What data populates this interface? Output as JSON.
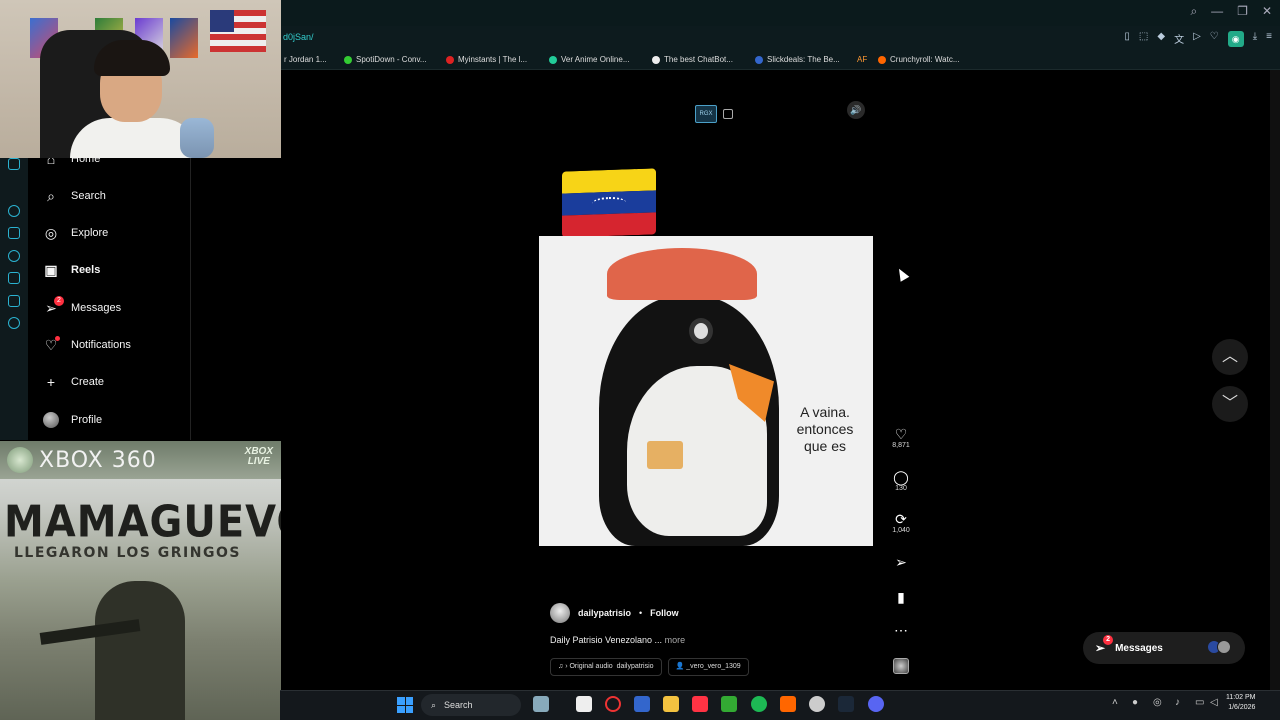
{
  "browser": {
    "url": "d0jSan/",
    "bookmarks": [
      "r Jordan 1...",
      "SpotiDown - Conv...",
      "Myinstants | The l...",
      "Ver Anime Online...",
      "The best ChatBot...",
      "Slickdeals: The Be...",
      "AF",
      "Crunchyroll: Watc..."
    ]
  },
  "sidebar": {
    "items": [
      {
        "label": "Home"
      },
      {
        "label": "Search"
      },
      {
        "label": "Explore"
      },
      {
        "label": "Reels"
      },
      {
        "label": "Messages",
        "badge": "2"
      },
      {
        "label": "Notifications"
      },
      {
        "label": "Create"
      },
      {
        "label": "Profile"
      }
    ]
  },
  "overlay_box": {
    "platform": "XBOX 360",
    "live_line1": "XBOX",
    "live_line2": "LIVE",
    "title": "MAMAGUEVO",
    "subtitle": "LLEGARON LOS GRINGOS"
  },
  "reel": {
    "badge": "RGX",
    "caption": "A vaina. entonces que es",
    "username": "dailypatrisio",
    "separator": "•",
    "follow": "Follow",
    "description": "Daily Patrisio Venezolano ...",
    "more": "more",
    "audio": "› Original audio",
    "audio_user": "dailypatrisio",
    "tagged_user": "_vero_vero_1309"
  },
  "actions": {
    "likes": "8,871",
    "comments": "130",
    "reposts": "1,040"
  },
  "messages_float": {
    "label": "Messages",
    "badge": "2"
  },
  "taskbar": {
    "search": "Search",
    "time": "11:02 PM",
    "date": "1/6/2026"
  },
  "colors": {
    "accent": "#2bb3d1",
    "badge": "#ff3040",
    "flag_yellow": "#f7d417",
    "flag_blue": "#1a3d9c",
    "flag_red": "#d6252f"
  }
}
